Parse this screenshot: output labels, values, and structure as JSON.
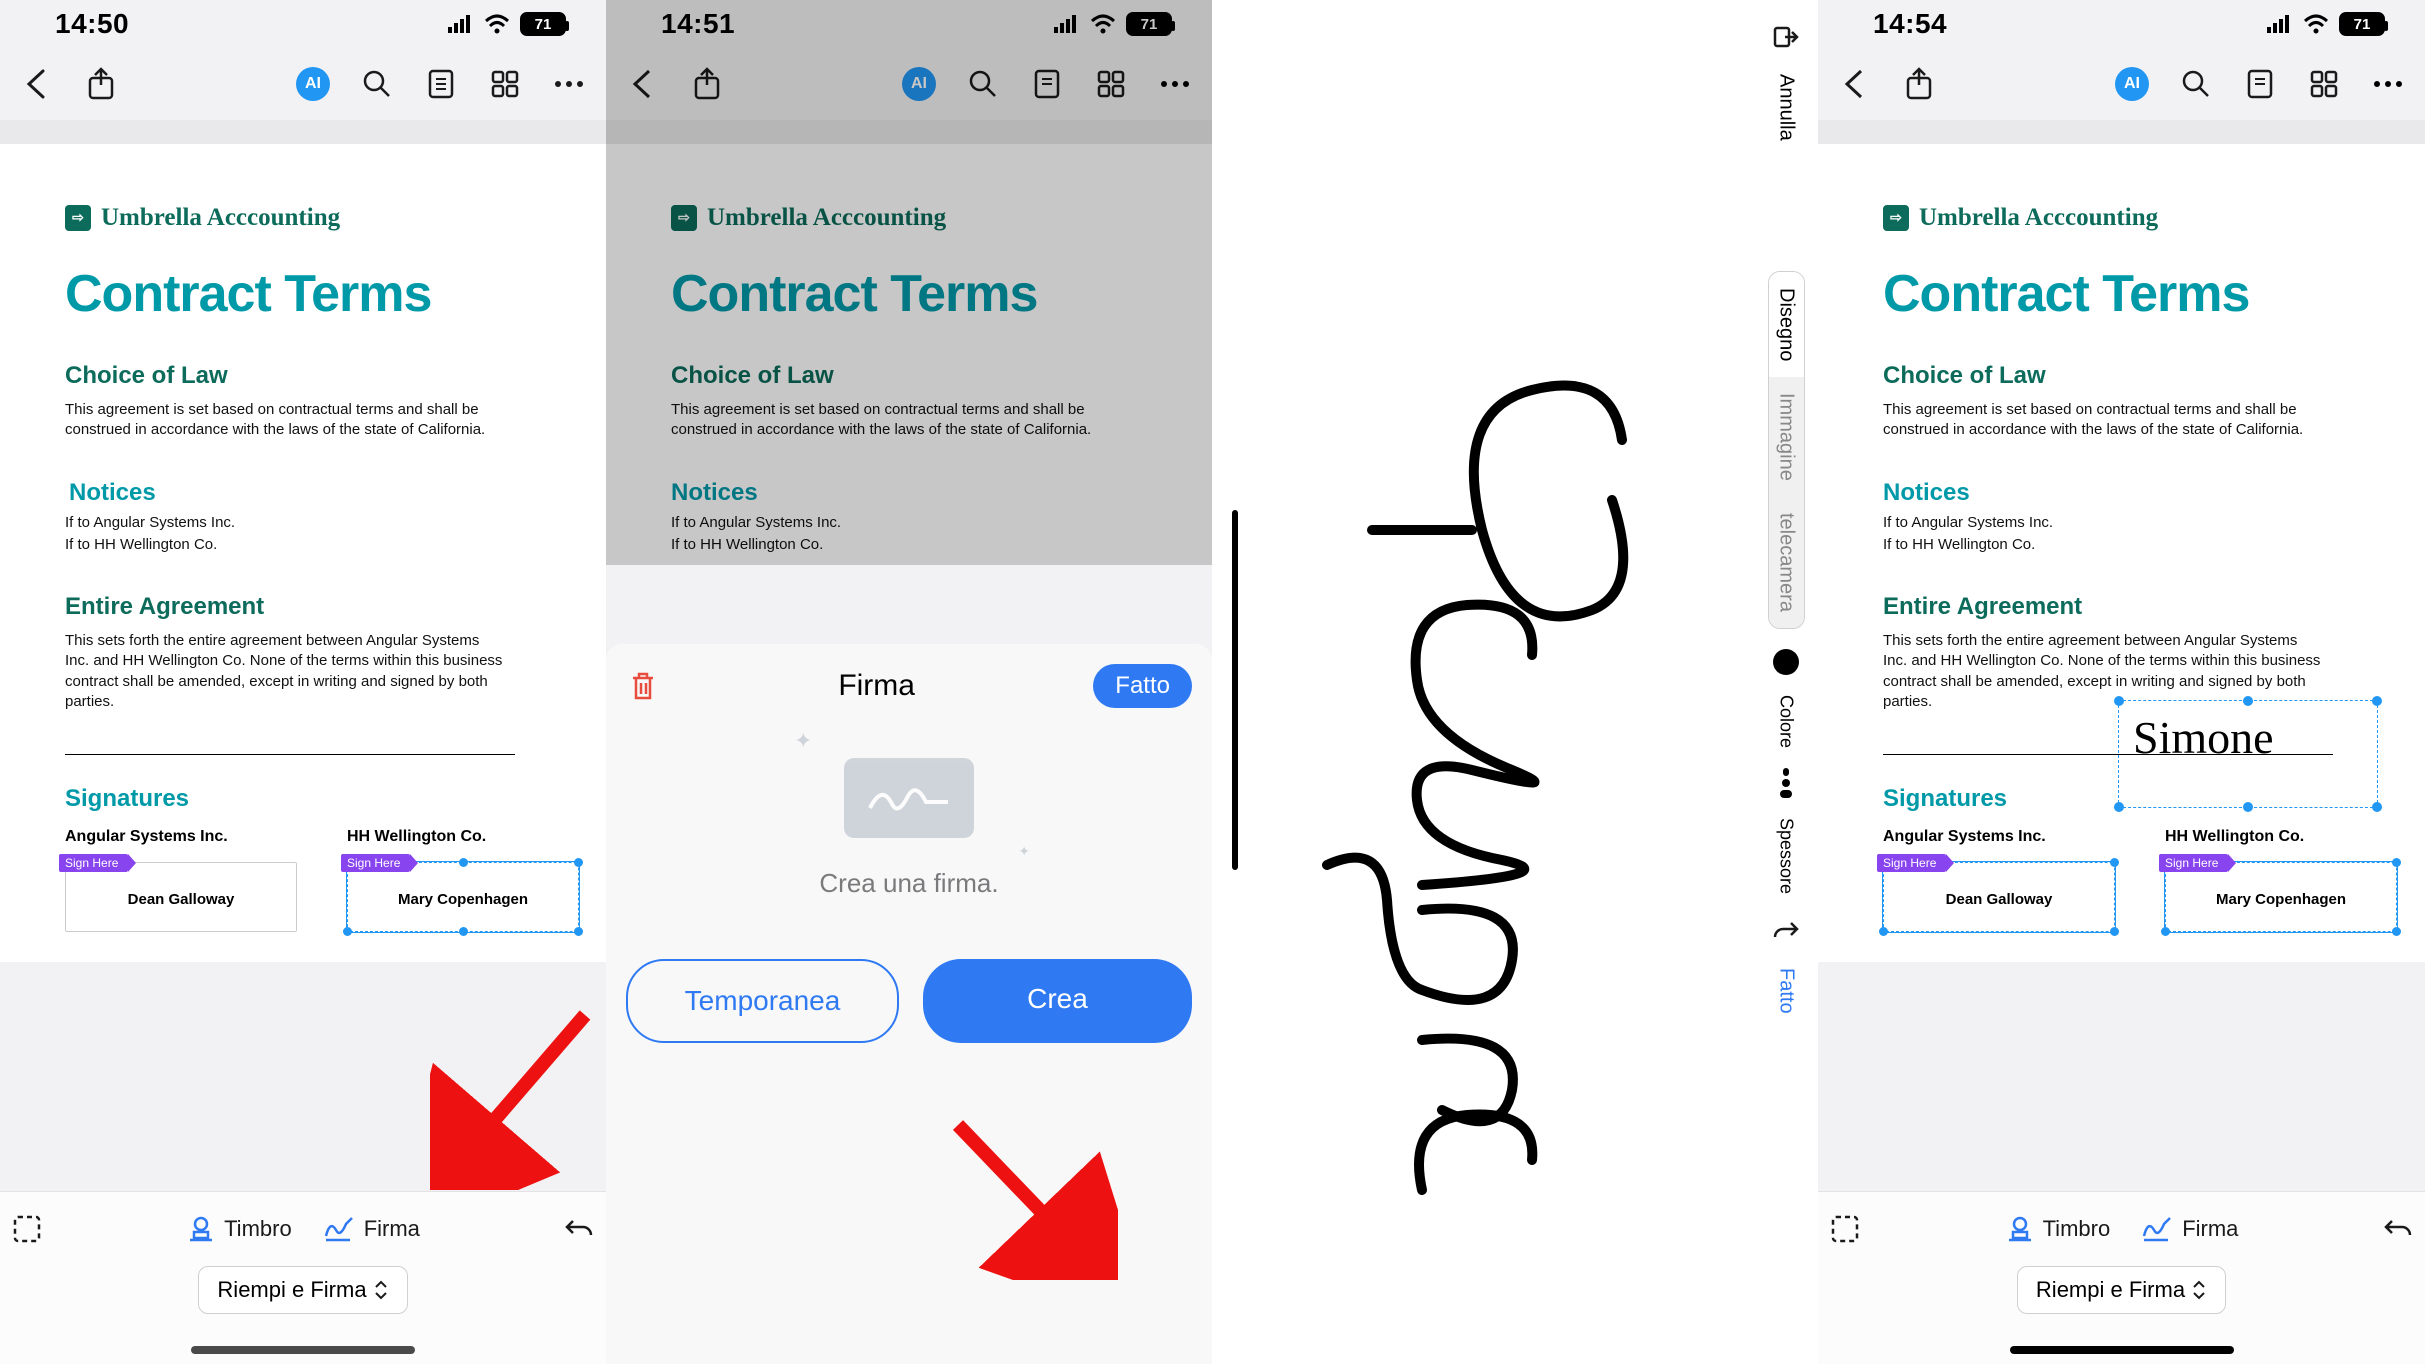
{
  "status": {
    "time1": "14:50",
    "time2": "14:51",
    "time3": "14:54",
    "battery": "71"
  },
  "toolbar": {
    "ai": "AI"
  },
  "doc": {
    "brand": "Umbrella Acccounting",
    "title": "Contract Terms",
    "h_choice": "Choice of Law",
    "p_choice": "This agreement is set based on contractual terms and shall be construed in accordance with the laws of the state of California.",
    "h_notices": "Notices",
    "p_not1": "If to Angular Systems Inc.",
    "p_not2": "If to HH Wellington Co.",
    "h_entire": "Entire Agreement",
    "p_entire": "This sets forth the entire agreement between Angular Systems Inc. and HH Wellington Co. None of the terms within this business contract shall be amended, except in writing and signed by both parties.",
    "h_sigs": "Signatures",
    "party1": "Angular Systems Inc.",
    "party2": "HH Wellington Co.",
    "sign_tag": "Sign Here",
    "sig_name1": "Dean Galloway",
    "sig_name2": "Mary Copenhagen"
  },
  "bottom": {
    "timbro": "Timbro",
    "firma": "Firma",
    "mode": "Riempi e Firma"
  },
  "sheet": {
    "title": "Firma",
    "done": "Fatto",
    "hint": "Crea una firma.",
    "temp": "Temporanea",
    "create": "Crea"
  },
  "draw": {
    "annulla": "Annulla",
    "disegno": "Disegno",
    "immagine": "Immagine",
    "telecamera": "telecamera",
    "colore": "Colore",
    "spessore": "Spessore",
    "fatto": "Fatto",
    "signature_text": "Simone"
  }
}
